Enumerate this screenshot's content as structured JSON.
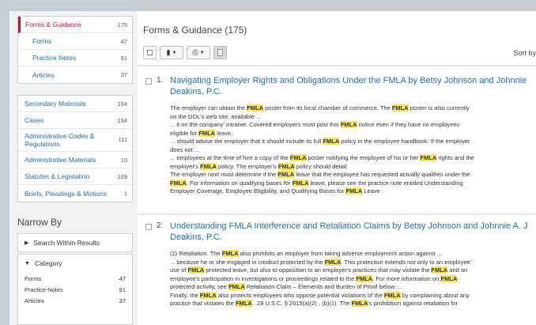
{
  "sidebar": {
    "groups": [
      {
        "label": "Forms & Guidance",
        "count": "175",
        "active": true
      },
      {
        "label": "Forms",
        "count": "47",
        "sub": true
      },
      {
        "label": "Practice Notes",
        "count": "91",
        "sub": true
      },
      {
        "label": "Articles",
        "count": "37",
        "sub": true
      }
    ],
    "groups2": [
      {
        "label": "Secondary Materials",
        "count": "104"
      },
      {
        "label": "Cases",
        "count": "194"
      },
      {
        "label": "Administrative Codes & Regulations",
        "count": "111",
        "tall": true
      },
      {
        "label": "Administrative Materials",
        "count": "10"
      },
      {
        "label": "Statutes & Legislation",
        "count": "169"
      },
      {
        "label": "Briefs, Pleadings & Motions",
        "count": "1"
      }
    ],
    "narrow_title": "Narrow By",
    "search_within": "Search Within Results",
    "category_label": "Category",
    "categories": [
      {
        "label": "Forms",
        "count": "47"
      },
      {
        "label": "Practice Notes",
        "count": "91"
      },
      {
        "label": "Articles",
        "count": "37"
      }
    ]
  },
  "main": {
    "title": "Forms & Guidance (175)",
    "sort_label": "Sort by",
    "results": [
      {
        "num": "1.",
        "title_line1": "Navigating Employer Rights and Obligations Under the FMLA by Betsy Johnson and Johnnie",
        "title_line2": "Deakins, P.C.",
        "snippet": [
          [
            "The employer can obtain the ",
            "FMLA",
            " poster from its local chamber of commerce. The ",
            "FMLA",
            " poster is also currently"
          ],
          [
            "on the DOL's web site, available ..."
          ],
          [
            "... it on the company' intranet. Covered employers must post this ",
            "FMLA",
            " notice even if they have no employees"
          ],
          [
            "eligible for ",
            "FMLA",
            " leave."
          ],
          [
            "... should advise the employer that it should include its full ",
            "FMLA",
            " policy in the employee handbook. If the employer"
          ],
          [
            "does not ..."
          ],
          [
            "... employees at the time of hire a copy of the ",
            "FMLA",
            " poster notifying the employee of his or her ",
            "FMLA",
            " rights and the"
          ],
          [
            "employer's ",
            "FMLA",
            " policy. The employer's ",
            "FMLA",
            " policy should detail:"
          ],
          [
            "The employer next must determine if the ",
            "FMLA",
            " leave that the employee has requested actually qualifies under the"
          ],
          [
            "FMLA",
            ". For information on qualifying bases for ",
            "FMLA",
            " leave, please see the practice note entitled Understanding"
          ],
          [
            "Employer Coverage, Employee Eligibility, and Qualifying Bases for ",
            "FMLA",
            " Leave ."
          ]
        ]
      },
      {
        "num": "2.",
        "title_line1": "Understanding FMLA Interference and Retaliation Claims by Betsy Johnson and Johnnie A. J",
        "title_line2": "Deakins, P.C.",
        "snippet": [
          [
            "(2) Retaliation. The ",
            "FMLA",
            " also prohibits an employer from taking adverse employment action against ..."
          ],
          [
            "... because he or she engaged in conduct protected by the ",
            "FMLA",
            ". This protection extends not only to an employee'"
          ],
          [
            "use of ",
            "FMLA",
            "-protected leave, but also to opposition to an employer's practices that may violate the ",
            "FMLA",
            " and an"
          ],
          [
            "employee's participation in investigations or proceedings related to the ",
            "FMLA",
            ". For more information on ",
            "FMLA",
            "-"
          ],
          [
            "protected activity, see ",
            "FMLA",
            " Retaliation Claim – Elements and Burden of Proof below. ..."
          ],
          [
            "Finally, the ",
            "FMLA",
            " also protects employees who oppose potential violations of the ",
            "FMLA",
            " by complaining about any"
          ],
          [
            "practice that violates the ",
            "FMLA",
            " . 29 U.S.C. § 2615(a)(2) , (b)(1). The ",
            "FMLA",
            "'s prohibition against retaliation for"
          ]
        ]
      }
    ]
  }
}
